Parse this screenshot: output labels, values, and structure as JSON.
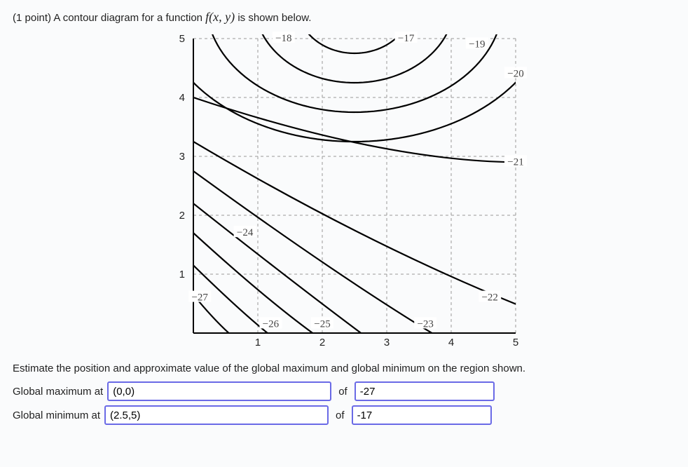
{
  "points_label": "(1 point)",
  "prompt": "A contour diagram for a function",
  "func": "f(x, y)",
  "prompt_tail": "is shown below.",
  "instruct": "Estimate the position and approximate value of the global maximum and global minimum on the region shown.",
  "rows": {
    "max_label": "Global maximum at",
    "min_label": "Global minimum at",
    "of": "of"
  },
  "answers": {
    "max_coord": "(0,0)",
    "max_val": "-27",
    "min_coord": "(2.5,5)",
    "min_val": "-17"
  },
  "chart_data": {
    "type": "contour",
    "xlabel": "",
    "ylabel": "",
    "xlim": [
      0,
      5
    ],
    "ylim": [
      0,
      5
    ],
    "xticks": [
      1,
      2,
      3,
      4,
      5
    ],
    "yticks": [
      1,
      2,
      3,
      4,
      5
    ],
    "grid": true,
    "contour_labels": [
      {
        "value": -18,
        "xy": [
          1.4,
          5.0
        ]
      },
      {
        "value": -17,
        "xy": [
          3.3,
          5.0
        ]
      },
      {
        "value": -19,
        "xy": [
          4.4,
          4.9
        ]
      },
      {
        "value": -20,
        "xy": [
          5.0,
          4.4
        ]
      },
      {
        "value": -21,
        "xy": [
          5.0,
          2.9
        ]
      },
      {
        "value": -22,
        "xy": [
          4.6,
          0.6
        ]
      },
      {
        "value": -23,
        "xy": [
          3.6,
          0.15
        ]
      },
      {
        "value": -25,
        "xy": [
          2.0,
          0.15
        ]
      },
      {
        "value": -26,
        "xy": [
          1.2,
          0.15
        ]
      },
      {
        "value": -27,
        "xy": [
          0.1,
          0.6
        ]
      },
      {
        "value": -24,
        "xy": [
          0.8,
          1.7
        ]
      }
    ],
    "series": [
      {
        "name": "-17",
        "value": -17,
        "type": "ellipse-arc",
        "cx": 2.5,
        "cy": 5.6,
        "rx": 0.9,
        "ry": 0.85,
        "a0": 200,
        "a1": 340
      },
      {
        "name": "-18",
        "value": -18,
        "type": "ellipse-arc",
        "cx": 2.5,
        "cy": 5.6,
        "rx": 1.55,
        "ry": 1.35,
        "a0": 195,
        "a1": 345
      },
      {
        "name": "-19",
        "value": -19,
        "type": "ellipse-arc",
        "cx": 2.5,
        "cy": 5.6,
        "rx": 2.3,
        "ry": 1.85,
        "a0": 195,
        "a1": 345
      },
      {
        "name": "-20",
        "value": -20,
        "type": "ellipse-arc",
        "cx": 2.5,
        "cy": 5.6,
        "rx": 3.05,
        "ry": 2.35,
        "a0": 205,
        "a1": 335
      },
      {
        "name": "-21",
        "value": -21,
        "type": "quad",
        "pts": [
          [
            0.0,
            4.0
          ],
          [
            3.0,
            2.9
          ],
          [
            5.1,
            2.9
          ]
        ]
      },
      {
        "name": "-22",
        "value": -22,
        "type": "quad",
        "pts": [
          [
            0.0,
            3.25
          ],
          [
            2.7,
            1.5
          ],
          [
            5.1,
            0.45
          ]
        ]
      },
      {
        "name": "-23",
        "value": -23,
        "type": "quad",
        "pts": [
          [
            0.0,
            2.75
          ],
          [
            2.2,
            1.0
          ],
          [
            3.7,
            0.0
          ]
        ]
      },
      {
        "name": "-24",
        "value": -24,
        "type": "quad",
        "pts": [
          [
            0.0,
            2.2
          ],
          [
            1.5,
            0.9
          ],
          [
            2.6,
            0.0
          ]
        ]
      },
      {
        "name": "-25",
        "value": -25,
        "type": "quad",
        "pts": [
          [
            0.0,
            1.7
          ],
          [
            1.1,
            0.6
          ],
          [
            1.85,
            0.0
          ]
        ]
      },
      {
        "name": "-26",
        "value": -26,
        "type": "quad",
        "pts": [
          [
            0.0,
            1.15
          ],
          [
            0.7,
            0.4
          ],
          [
            1.15,
            0.0
          ]
        ]
      },
      {
        "name": "-27",
        "value": -27,
        "type": "quad",
        "pts": [
          [
            0.0,
            0.65
          ],
          [
            0.3,
            0.25
          ],
          [
            0.55,
            0.0
          ]
        ]
      }
    ]
  }
}
